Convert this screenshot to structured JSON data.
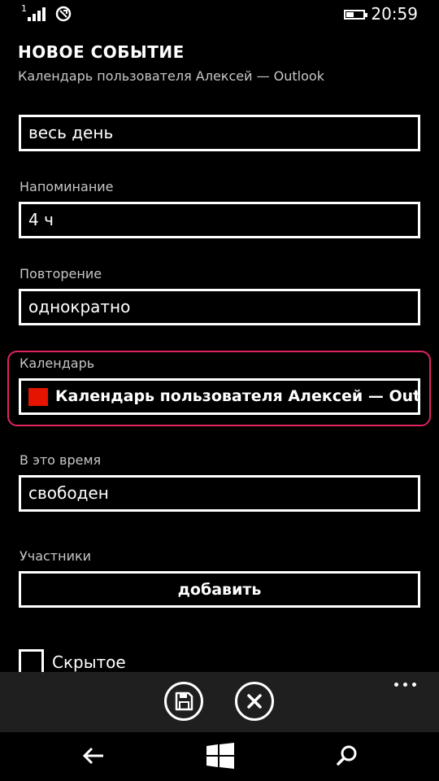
{
  "status_bar": {
    "time": "20:59",
    "signal_label": "1",
    "battery_level": 0.45
  },
  "header": {
    "title": "НОВОЕ СОБЫТИЕ",
    "subtitle": "Календарь пользователя Алексей — Outlook"
  },
  "fields": {
    "duration_value": "весь день",
    "reminder": {
      "label": "Напоминание",
      "value": "4 ч"
    },
    "repeat": {
      "label": "Повторение",
      "value": "однократно"
    },
    "calendar": {
      "label": "Календарь",
      "value": "Календарь пользователя Алексей — Outlo",
      "color": "#e51400"
    },
    "status": {
      "label": "В это время",
      "value": "свободен"
    },
    "attendees": {
      "label": "Участники",
      "button_label": "добавить"
    },
    "private": {
      "label": "Скрытое",
      "checked": false
    }
  },
  "app_bar": {
    "buttons": [
      "save-icon",
      "cancel-icon"
    ],
    "more": "more-icon"
  },
  "nav_bar": {
    "buttons": [
      "back-arrow-icon",
      "windows-start-icon",
      "search-icon"
    ]
  },
  "colors": {
    "background": "#000000",
    "highlight": "#e0245e",
    "app_bar": "#1f1f1f"
  }
}
